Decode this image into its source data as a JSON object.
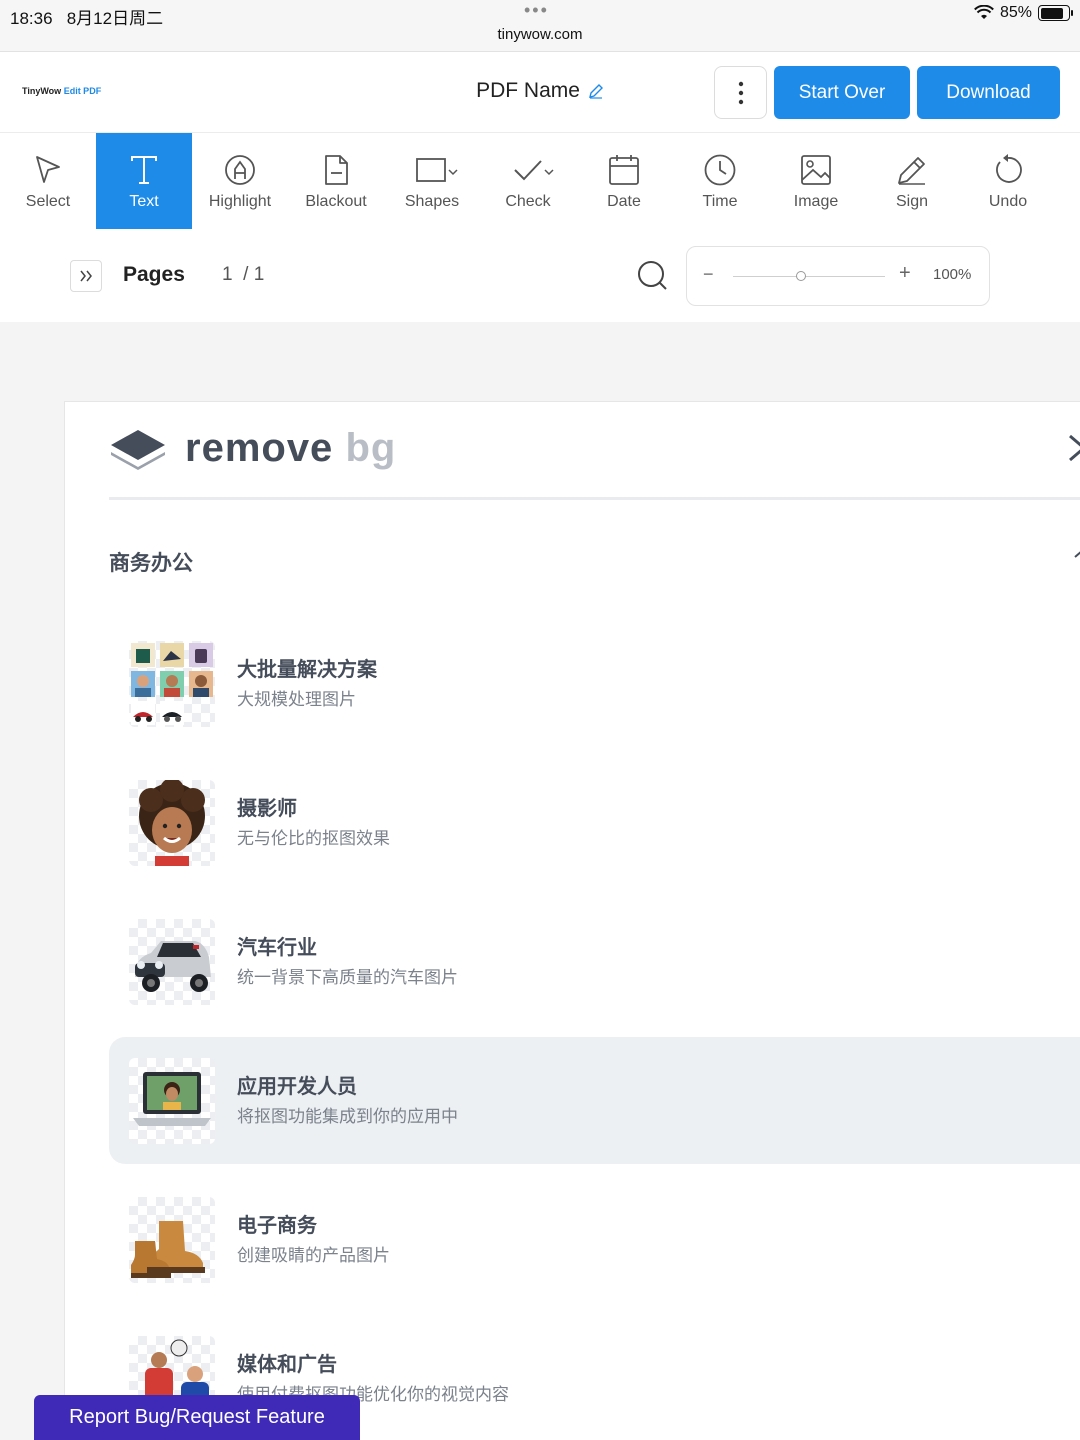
{
  "status_bar": {
    "time": "18:36",
    "date": "8月12日周二",
    "dots": "•••",
    "url": "tinywow.com",
    "battery": "85%",
    "battery_level": 0.85
  },
  "header": {
    "logo_brand": "TinyWow",
    "logo_product": "Edit PDF",
    "pdf_name": "PDF Name",
    "start_over": "Start Over",
    "download": "Download"
  },
  "toolbar": {
    "active": "Text",
    "tools": [
      {
        "label": "Select",
        "icon": "cursor-icon"
      },
      {
        "label": "Text",
        "icon": "text-icon"
      },
      {
        "label": "Highlight",
        "icon": "highlight-icon"
      },
      {
        "label": "Blackout",
        "icon": "blackout-icon"
      },
      {
        "label": "Shapes",
        "icon": "shapes-icon"
      },
      {
        "label": "Check",
        "icon": "check-icon"
      },
      {
        "label": "Date",
        "icon": "calendar-icon"
      },
      {
        "label": "Time",
        "icon": "clock-icon"
      },
      {
        "label": "Image",
        "icon": "image-icon"
      },
      {
        "label": "Sign",
        "icon": "pen-icon"
      },
      {
        "label": "Undo",
        "icon": "undo-icon"
      }
    ]
  },
  "pages_bar": {
    "label": "Pages",
    "current": "1",
    "separator": "/",
    "total": "1",
    "zoom_minus": "−",
    "zoom_plus": "+",
    "zoom": "100%",
    "zoom_slider_level": 0.45
  },
  "document": {
    "brand": "remove",
    "brand_accent": "bg",
    "section_title": "商务办公",
    "items": [
      {
        "title": "大批量解决方案",
        "subtitle": "大规模处理图片",
        "thumb": "batch-grid"
      },
      {
        "title": "摄影师",
        "subtitle": "无与伦比的抠图效果",
        "thumb": "portrait-child"
      },
      {
        "title": "汽车行业",
        "subtitle": "统一背景下高质量的汽车图片",
        "thumb": "car"
      },
      {
        "title": "应用开发人员",
        "subtitle": "将抠图功能集成到你的应用中",
        "thumb": "laptop",
        "highlighted": true
      },
      {
        "title": "电子商务",
        "subtitle": "创建吸睛的产品图片",
        "thumb": "boots"
      },
      {
        "title": "媒体和广告",
        "subtitle": "使用付费抠图功能优化你的视觉内容",
        "thumb": "football-players"
      }
    ]
  },
  "report_button": "Report Bug/Request Feature",
  "colors": {
    "accent": "#1e8be8",
    "report": "#3e2ab7",
    "brand_dark": "#454d5a",
    "brand_light": "#b9bec6"
  }
}
